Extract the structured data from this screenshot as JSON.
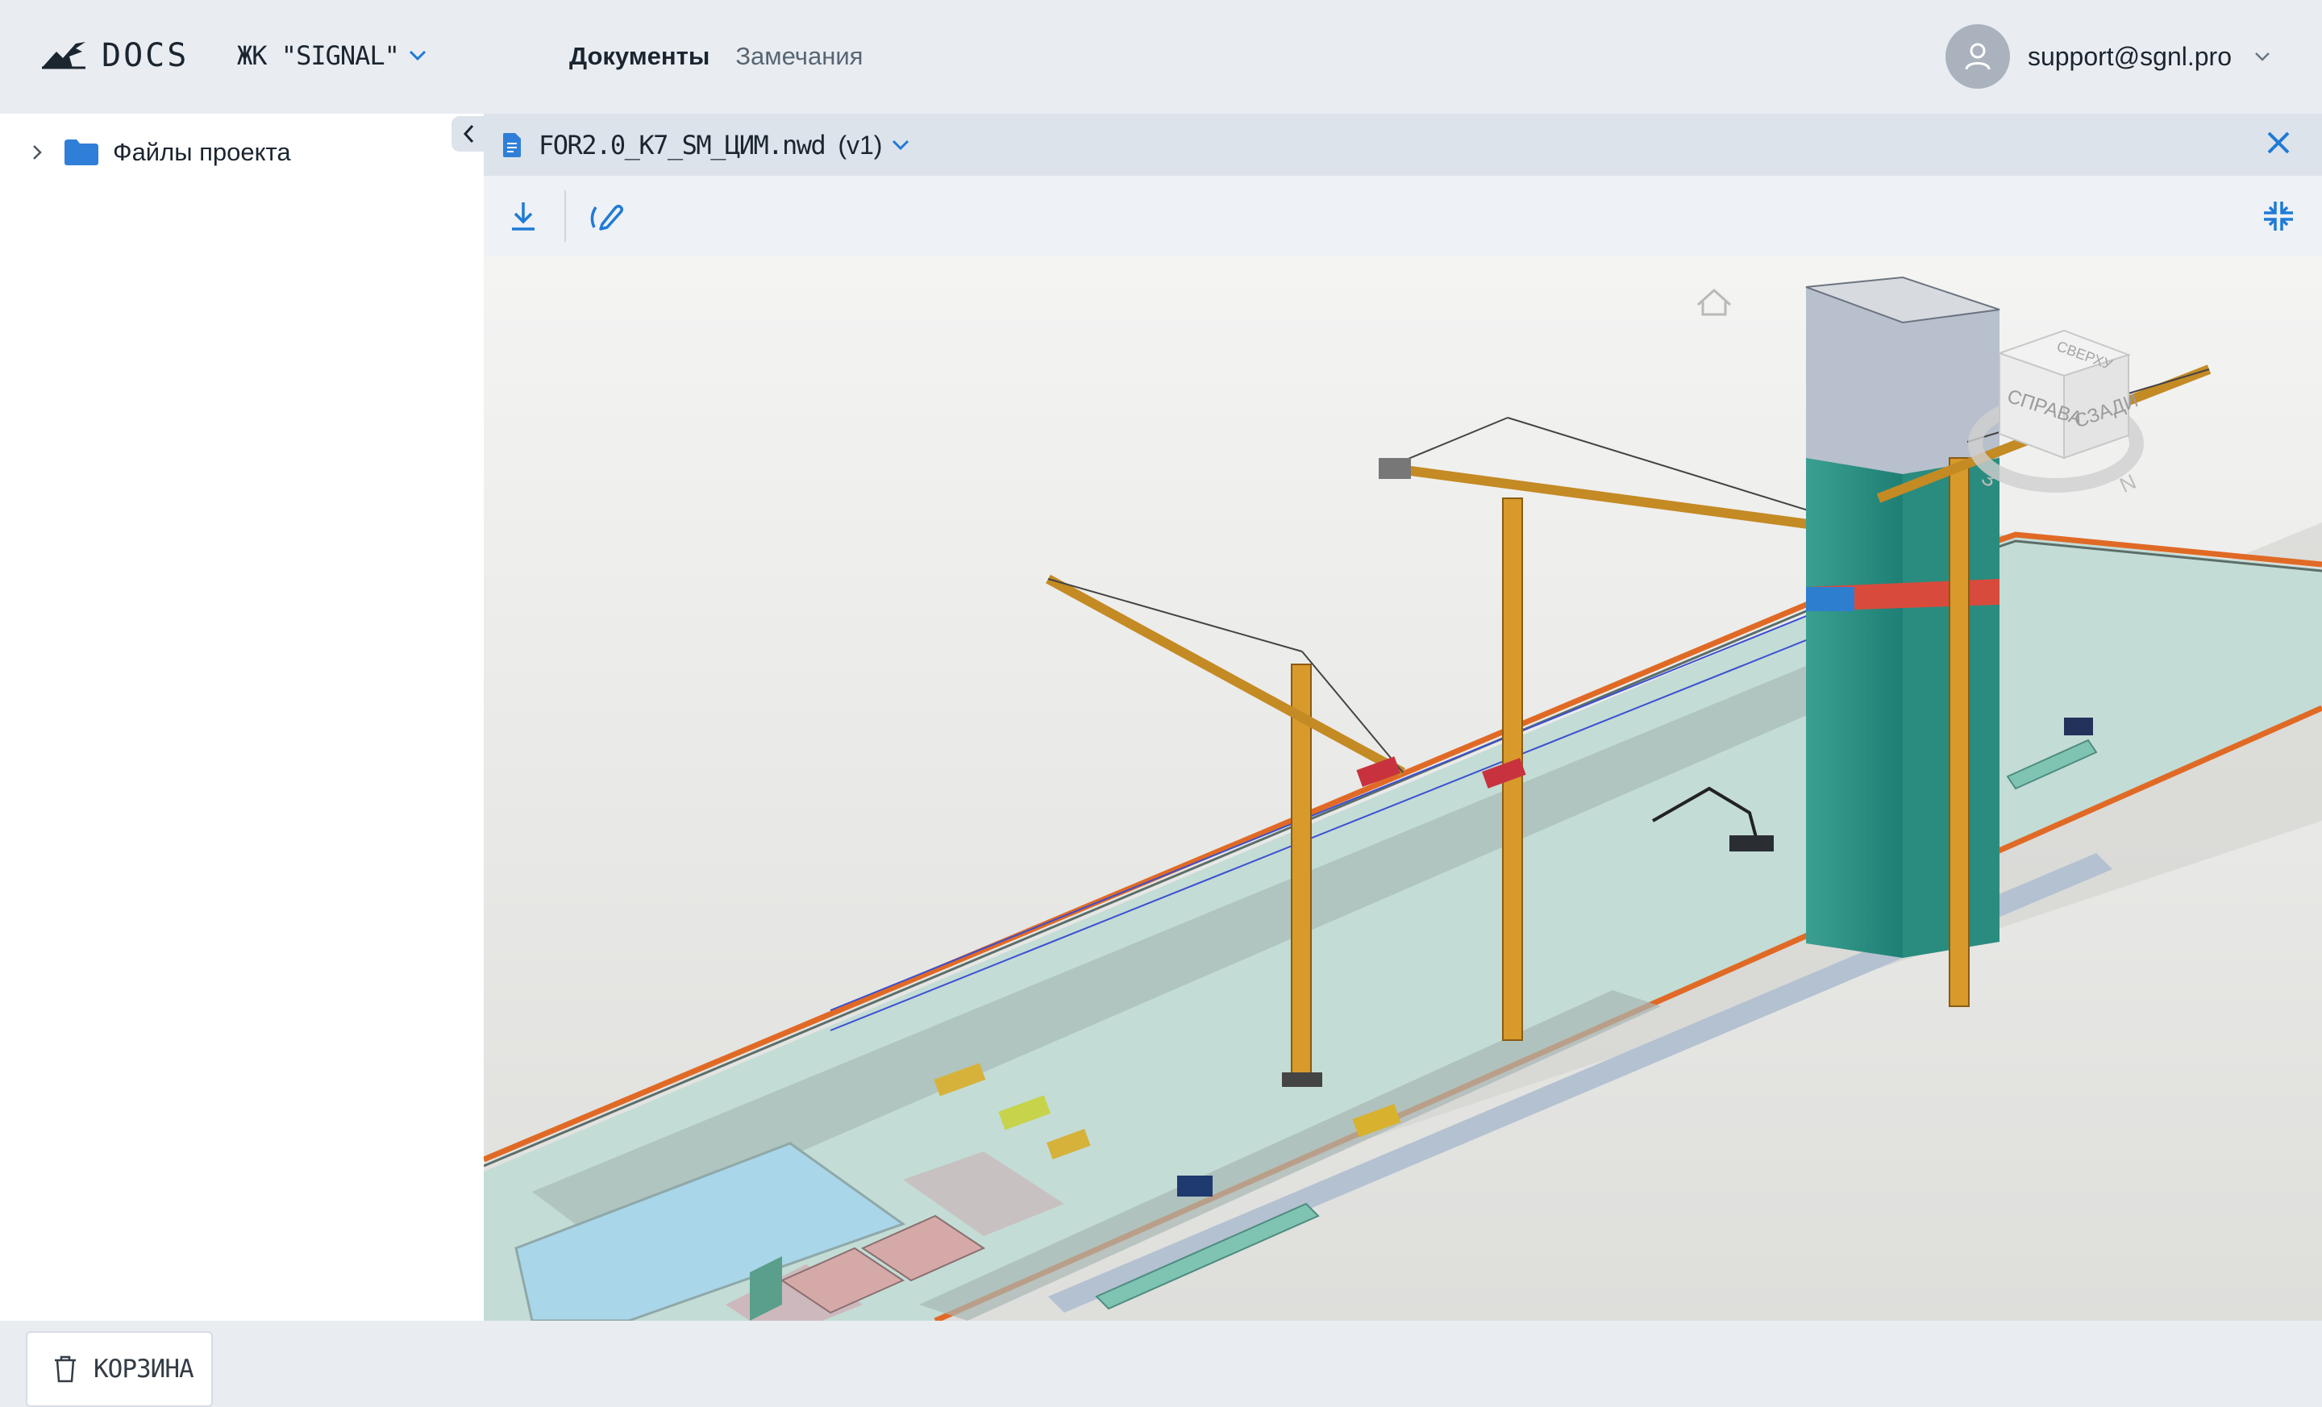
{
  "app": {
    "logo_text": "DOCS"
  },
  "project_selector": {
    "label": "ЖК \"SIGNAL\""
  },
  "nav": {
    "documents": "Документы",
    "remarks": "Замечания"
  },
  "user": {
    "email": "support@sgnl.pro"
  },
  "sidebar": {
    "tree_root": "Файлы проекта",
    "trash_label": "КОРЗИНА"
  },
  "document": {
    "filename": "FOR2.0_K7_SM_ЦИМ.nwd",
    "version": "(v1)"
  },
  "viewcube": {
    "face_right": "СПРАВА",
    "face_back": "СЗАДИ",
    "face_top": "СВЕРХУ",
    "compass_w": "З",
    "compass_n": "N"
  },
  "icons": [
    "logo-icon",
    "chevron-down-icon",
    "user-icon",
    "chevron-right-icon",
    "folder-icon",
    "chevron-left-icon",
    "trash-icon",
    "document-icon",
    "close-icon",
    "download-icon",
    "markup-pen-icon",
    "collapse-icon",
    "home-icon"
  ],
  "colors": {
    "accent": "#1f7ad6",
    "folder": "#2f7fd8",
    "topbar": "#e9edf2",
    "building_glass": "#2e9c8c"
  }
}
